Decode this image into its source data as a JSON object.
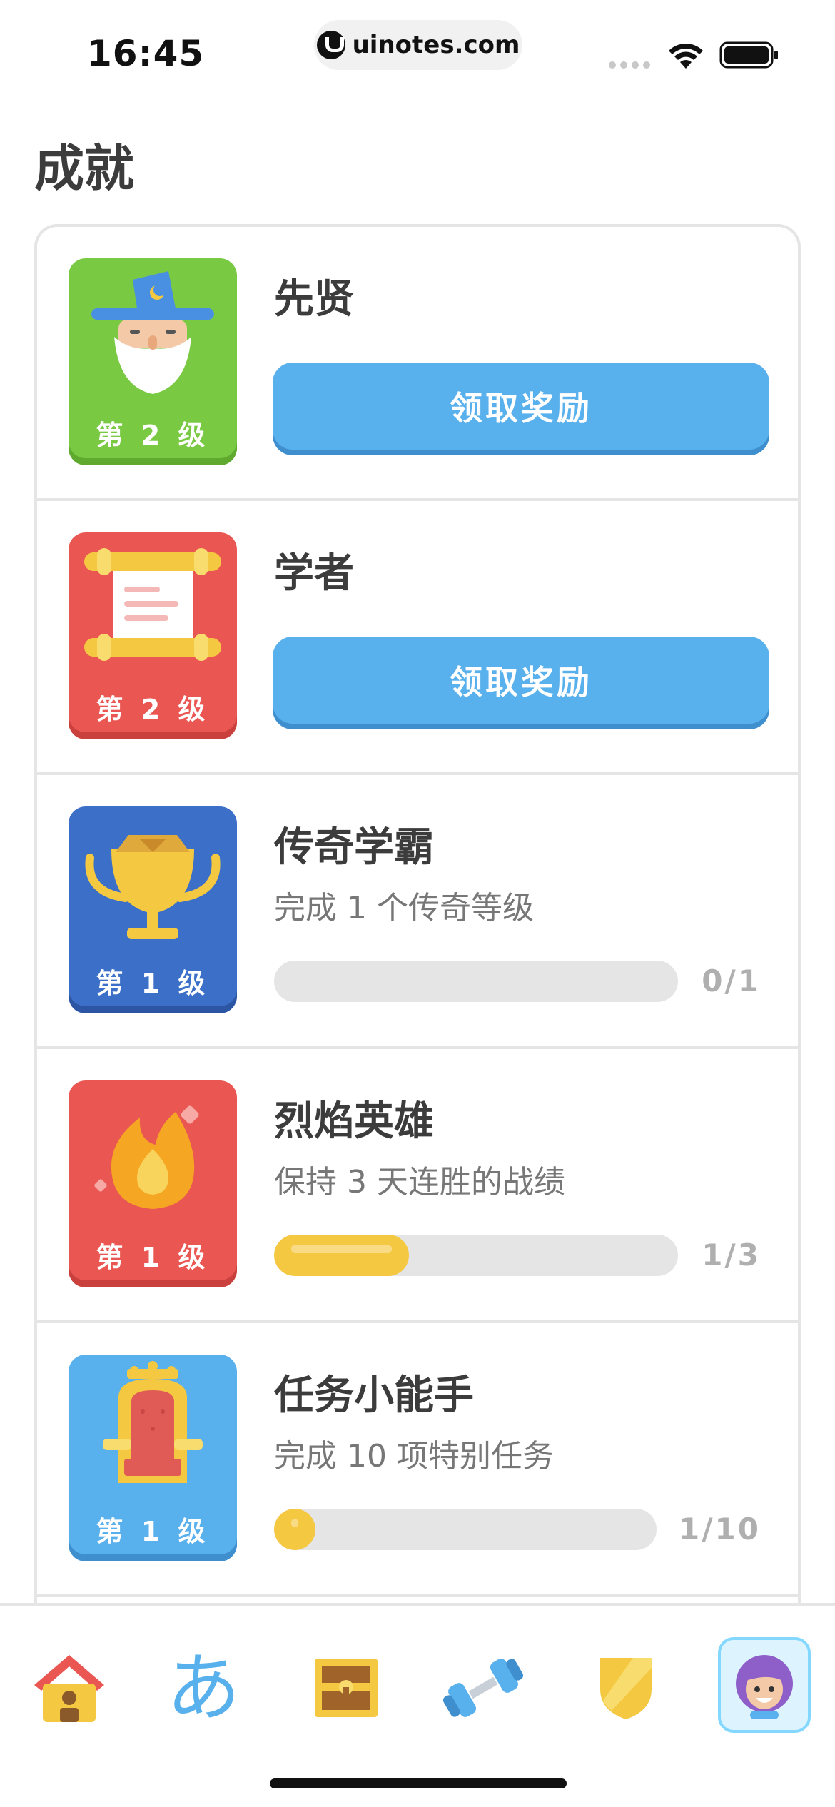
{
  "status_bar": {
    "time": "16:45",
    "url": "uinotes.com"
  },
  "page": {
    "title": "成就"
  },
  "achievements": [
    {
      "name": "先贤",
      "level": "第 2 级",
      "action_label": "领取奖励",
      "badge_color": "#7ac943",
      "icon": "wizard-icon"
    },
    {
      "name": "学者",
      "level": "第 2 级",
      "action_label": "领取奖励",
      "badge_color": "#ea5753",
      "icon": "scroll-icon"
    },
    {
      "name": "传奇学霸",
      "level": "第 1 级",
      "description": "完成 1 个传奇等级",
      "progress_text": "0/1",
      "progress": 0.0,
      "badge_color": "#3b6fc8",
      "icon": "trophy-icon"
    },
    {
      "name": "烈焰英雄",
      "level": "第 1 级",
      "description": "保持 3 天连胜的战绩",
      "progress_text": "1/3",
      "progress": 0.3333,
      "badge_color": "#ea5753",
      "icon": "flame-icon"
    },
    {
      "name": "任务小能手",
      "level": "第 1 级",
      "description": "完成 10 项特别任务",
      "progress_text": "1/10",
      "progress": 0.1,
      "badge_color": "#58b0ec",
      "icon": "throne-icon"
    }
  ],
  "tab_bar": {
    "active_tab": "profile",
    "tabs": [
      {
        "id": "home",
        "icon": "home-icon"
      },
      {
        "id": "characters",
        "icon": "hiragana-icon",
        "glyph": "あ"
      },
      {
        "id": "stories",
        "icon": "treasure-chest-icon"
      },
      {
        "id": "practice",
        "icon": "dumbbell-icon"
      },
      {
        "id": "leagues",
        "icon": "shield-icon"
      },
      {
        "id": "profile",
        "icon": "avatar-icon"
      }
    ]
  },
  "colors": {
    "accent_blue": "#58b0ec",
    "progress_yellow": "#f5c842",
    "border_gray": "#e5e5e5"
  }
}
